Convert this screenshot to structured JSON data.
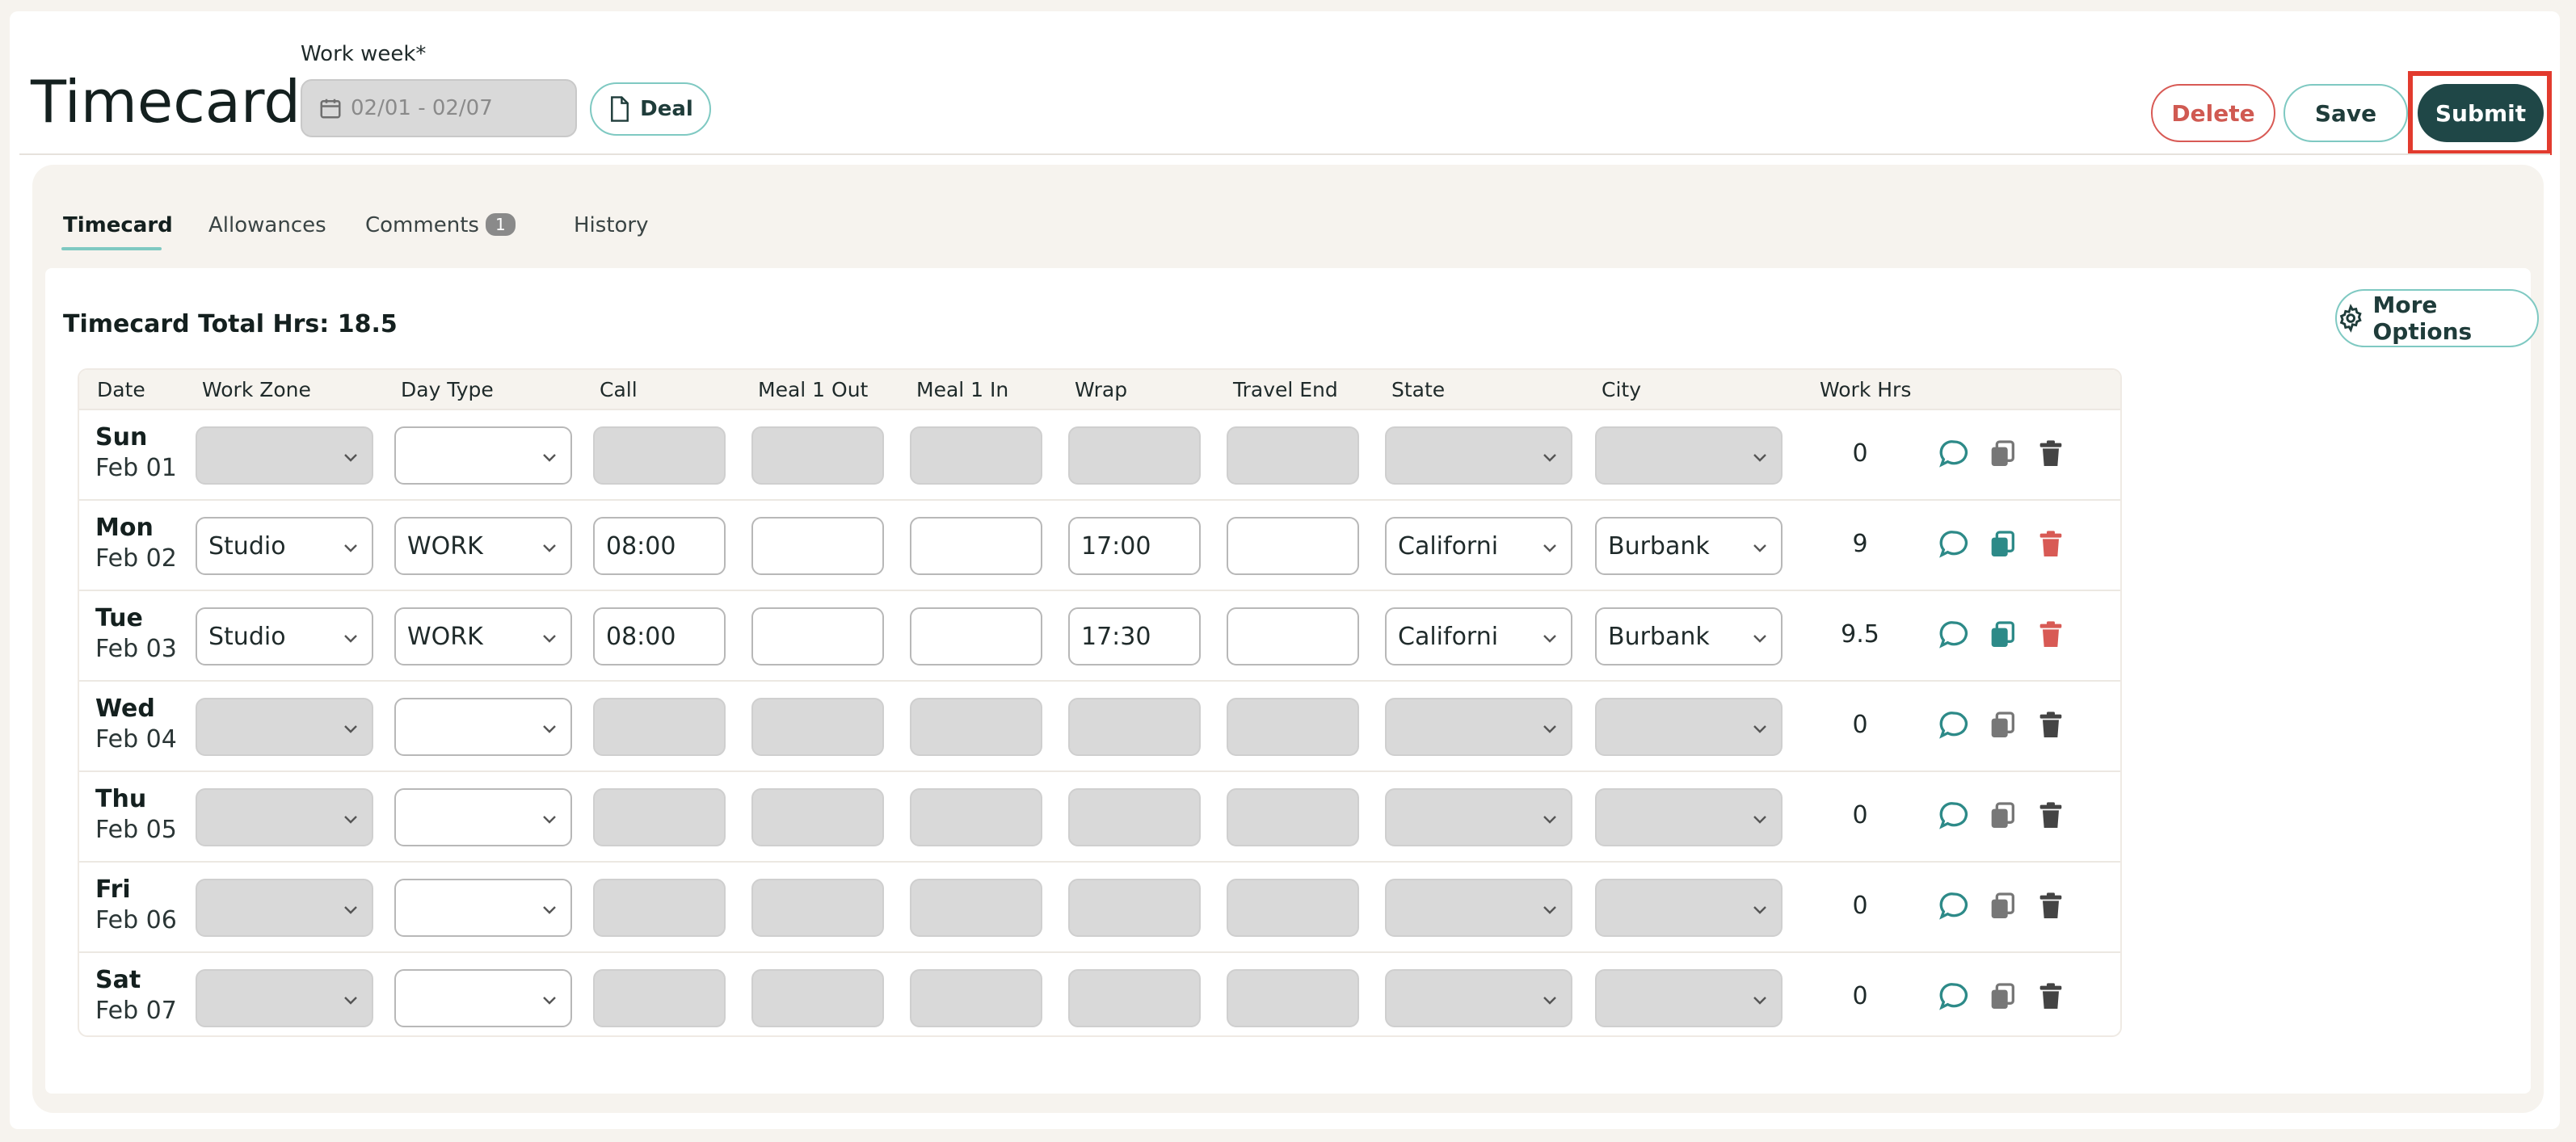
{
  "header": {
    "title": "Timecard",
    "work_week_label": "Work week*",
    "work_week_value": "02/01 - 02/07",
    "deal_label": "Deal",
    "delete_label": "Delete",
    "save_label": "Save",
    "submit_label": "Submit"
  },
  "tabs": [
    {
      "label": "Timecard"
    },
    {
      "label": "Allowances"
    },
    {
      "label": "Comments",
      "badge": "1"
    },
    {
      "label": "History"
    }
  ],
  "summary": {
    "total": "Timecard Total Hrs: 18.5",
    "more_options": "More Options"
  },
  "columns": [
    "Date",
    "Work Zone",
    "Day Type",
    "Call",
    "Meal 1 Out",
    "Meal 1 In",
    "Wrap",
    "Travel End",
    "State",
    "City",
    "Work Hrs"
  ],
  "rows": [
    {
      "day": "Sun",
      "date": "Feb 01",
      "work_zone": "",
      "day_type": "",
      "call": "",
      "meal_out": "",
      "meal_in": "",
      "wrap": "",
      "travel_end": "",
      "state": "",
      "city": "",
      "hrs": "0"
    },
    {
      "day": "Mon",
      "date": "Feb 02",
      "work_zone": "Studio",
      "day_type": "WORK",
      "call": "08:00",
      "meal_out": "",
      "meal_in": "",
      "wrap": "17:00",
      "travel_end": "",
      "state": "Californi",
      "city": "Burbank",
      "hrs": "9"
    },
    {
      "day": "Tue",
      "date": "Feb 03",
      "work_zone": "Studio",
      "day_type": "WORK",
      "call": "08:00",
      "meal_out": "",
      "meal_in": "",
      "wrap": "17:30",
      "travel_end": "",
      "state": "Californi",
      "city": "Burbank",
      "hrs": "9.5"
    },
    {
      "day": "Wed",
      "date": "Feb 04",
      "work_zone": "",
      "day_type": "",
      "call": "",
      "meal_out": "",
      "meal_in": "",
      "wrap": "",
      "travel_end": "",
      "state": "",
      "city": "",
      "hrs": "0"
    },
    {
      "day": "Thu",
      "date": "Feb 05",
      "work_zone": "",
      "day_type": "",
      "call": "",
      "meal_out": "",
      "meal_in": "",
      "wrap": "",
      "travel_end": "",
      "state": "",
      "city": "",
      "hrs": "0"
    },
    {
      "day": "Fri",
      "date": "Feb 06",
      "work_zone": "",
      "day_type": "",
      "call": "",
      "meal_out": "",
      "meal_in": "",
      "wrap": "",
      "travel_end": "",
      "state": "",
      "city": "",
      "hrs": "0"
    },
    {
      "day": "Sat",
      "date": "Feb 07",
      "work_zone": "",
      "day_type": "",
      "call": "",
      "meal_out": "",
      "meal_in": "",
      "wrap": "",
      "travel_end": "",
      "state": "",
      "city": "",
      "hrs": "0"
    }
  ],
  "colors": {
    "accent": "#7fc9c2",
    "submit_bg": "#1f4747",
    "delete": "#d85a55",
    "highlight": "#e23b2e",
    "comment_icon": "#2d8a88",
    "copy_active": "#2d8a88",
    "copy_inactive": "#777777",
    "trash_active": "#d85a55",
    "trash_inactive": "#444444"
  }
}
